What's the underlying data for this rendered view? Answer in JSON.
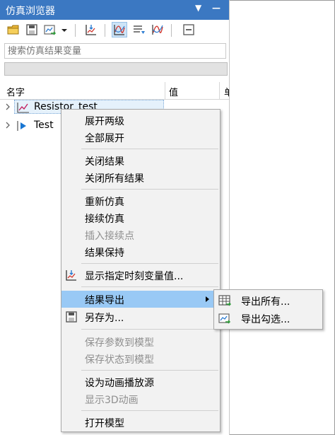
{
  "window": {
    "title": "仿真浏览器",
    "dropdown_glyph": "▼",
    "minimize_glyph": "—"
  },
  "toolbar": {
    "buttons": [
      {
        "name": "open-folder-icon"
      },
      {
        "name": "save-disk-icon"
      },
      {
        "name": "export-chart-icon",
        "has_dropdown": true
      },
      {
        "name": "plot-variable-icon"
      },
      {
        "name": "curve-mode-icon",
        "active": true
      },
      {
        "name": "filter-list-icon"
      },
      {
        "name": "curve-compare-icon"
      },
      {
        "name": "collapse-all-icon"
      }
    ]
  },
  "search": {
    "placeholder": "搜索仿真结果变量",
    "value": ""
  },
  "progress": {
    "fraction": 0
  },
  "columns": {
    "name": "名字",
    "value": "值",
    "unit": "单"
  },
  "tree": [
    {
      "label": "Resistor_test",
      "icon": "result-curve-icon",
      "selected": true
    },
    {
      "label": "Test",
      "icon": "play-model-icon",
      "selected": false
    }
  ],
  "context_menu": {
    "items": [
      {
        "label": "展开两级",
        "enabled": true
      },
      {
        "label": "全部展开",
        "enabled": true
      },
      {
        "separator": true
      },
      {
        "label": "关闭结果",
        "enabled": true
      },
      {
        "label": "关闭所有结果",
        "enabled": true
      },
      {
        "separator": true
      },
      {
        "label": "重新仿真",
        "enabled": true
      },
      {
        "label": "接续仿真",
        "enabled": true
      },
      {
        "label": "插入接续点",
        "enabled": false
      },
      {
        "label": "结果保持",
        "enabled": true
      },
      {
        "separator": true
      },
      {
        "label": "显示指定时刻变量值...",
        "enabled": true,
        "icon": "plot-variable-icon"
      },
      {
        "separator": true
      },
      {
        "label": "结果导出",
        "enabled": true,
        "highlighted": true,
        "submenu": true
      },
      {
        "label": "另存为...",
        "enabled": true,
        "icon": "save-disk-icon"
      },
      {
        "separator": true
      },
      {
        "label": "保存参数到模型",
        "enabled": false
      },
      {
        "label": "保存状态到模型",
        "enabled": false
      },
      {
        "separator": true
      },
      {
        "label": "设为动画播放源",
        "enabled": true
      },
      {
        "label": "显示3D动画",
        "enabled": false
      },
      {
        "separator": true
      },
      {
        "label": "打开模型",
        "enabled": true
      }
    ]
  },
  "submenu": {
    "items": [
      {
        "label": "导出所有...",
        "icon": "table-grid-icon"
      },
      {
        "label": "导出勾选...",
        "icon": "export-checked-icon"
      }
    ]
  },
  "colors": {
    "title_bar": "#3b78c2",
    "menu_bg": "#f2f2f2",
    "highlight": "#99c9f5",
    "selection": "#e5f1fb"
  }
}
